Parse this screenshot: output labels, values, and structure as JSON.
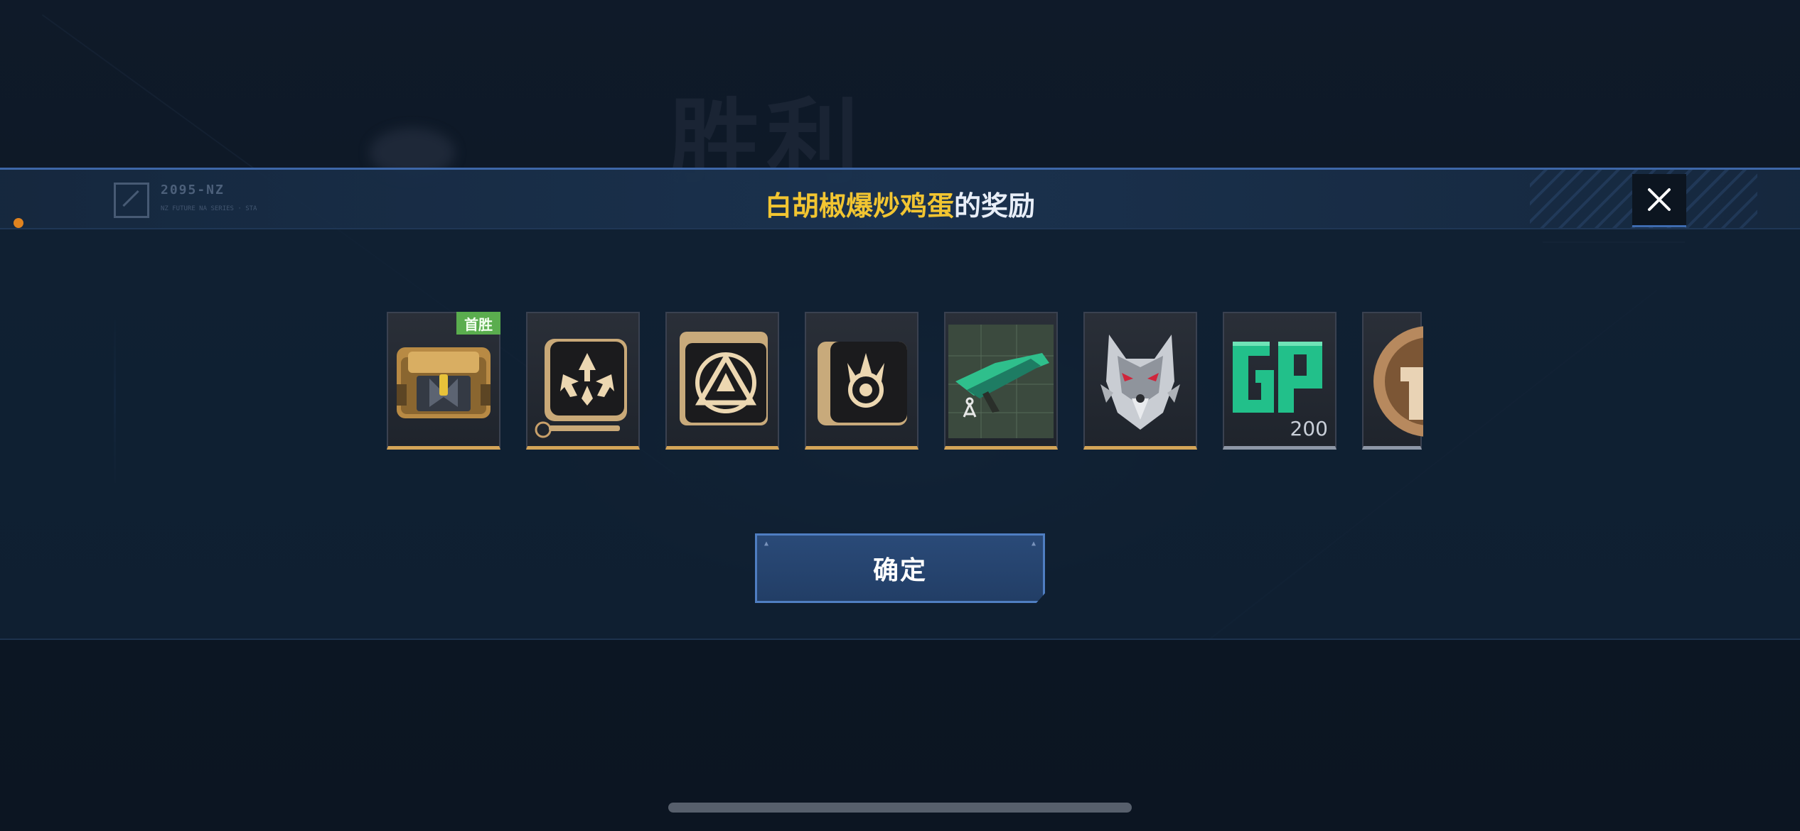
{
  "background": {
    "title": "胜利"
  },
  "dialog": {
    "title_name": "白胡椒爆炒鸡蛋",
    "title_suffix": "的奖励",
    "logo_text": "2095-NZ",
    "logo_sub": "NZ FUTURE NA SERIES · STA"
  },
  "items": [
    {
      "icon": "treasure-chest-icon",
      "badge": "首胜",
      "quantity": "",
      "rarity": "gold"
    },
    {
      "icon": "arrow-emblem-card-icon",
      "badge": "",
      "quantity": "",
      "rarity": "gold"
    },
    {
      "icon": "triangle-emblem-card-icon",
      "badge": "",
      "quantity": "",
      "rarity": "gold"
    },
    {
      "icon": "crown-emblem-card-icon",
      "badge": "",
      "quantity": "",
      "rarity": "gold"
    },
    {
      "icon": "weapon-blueprint-icon",
      "badge": "",
      "quantity": "",
      "rarity": "gold"
    },
    {
      "icon": "wolf-head-icon",
      "badge": "",
      "quantity": "",
      "rarity": "gold"
    },
    {
      "icon": "gp-currency-icon",
      "badge": "",
      "quantity": "200",
      "rarity": "silver"
    },
    {
      "icon": "bronze-coin-icon",
      "badge": "",
      "quantity": "",
      "rarity": "silver"
    }
  ],
  "confirm_button": {
    "label": "确定"
  },
  "colors": {
    "title_name": "#f2c531",
    "title_suffix": "#e8eef8",
    "accent_blue": "#3d67a8",
    "gold_rarity": "#d4a558",
    "badge_green": "#5aad4e",
    "gp_green": "#22c08a"
  }
}
